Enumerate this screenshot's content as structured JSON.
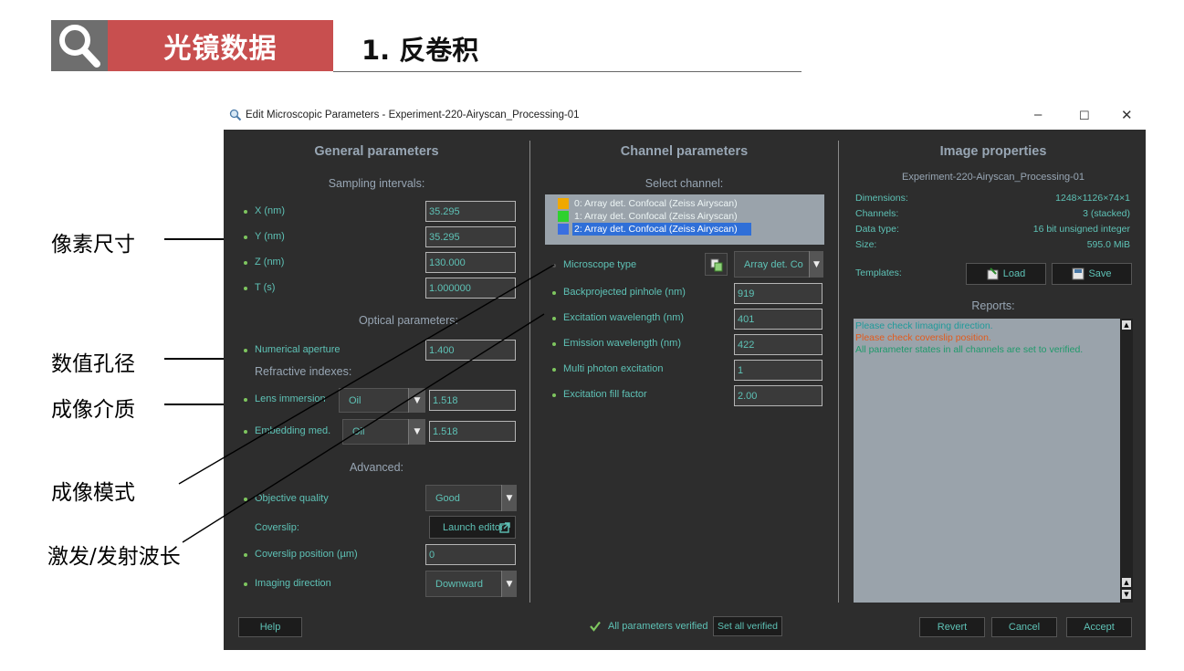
{
  "header": {
    "badge": "光镜数据",
    "title": "1. 反卷积"
  },
  "annotations": {
    "pixel_size": "像素尺寸",
    "numerical_aperture": "数值孔径",
    "imaging_medium": "成像介质",
    "imaging_mode": "成像模式",
    "excitation_emission": "激发/发射波长"
  },
  "window": {
    "title": "Edit Microscopic Parameters - Experiment-220-Airyscan_Processing-01",
    "minimize": "–",
    "maximize": "☐",
    "close": "✕"
  },
  "general": {
    "title": "General parameters",
    "sampling_title": "Sampling intervals:",
    "x_label": "X (nm)",
    "x_value": "35.295",
    "y_label": "Y (nm)",
    "y_value": "35.295",
    "z_label": "Z (nm)",
    "z_value": "130.000",
    "t_label": "T (s)",
    "t_value": "1.000000",
    "optical_title": "Optical parameters:",
    "na_label": "Numerical aperture",
    "na_value": "1.400",
    "refractive_title": "Refractive indexes:",
    "lens_label": "Lens immersion",
    "lens_medium": "Oil",
    "lens_value": "1.518",
    "embed_label": "Embedding med.",
    "embed_medium": "Oil",
    "embed_value": "1.518",
    "advanced_title": "Advanced:",
    "objective_label": "Objective quality",
    "objective_value": "Good",
    "coverslip_label": "Coverslip:",
    "launch_editor": "Launch editor",
    "coverslip_pos_label": "Coverslip position (µm)",
    "coverslip_pos_value": "0",
    "imaging_dir_label": "Imaging direction",
    "imaging_dir_value": "Downward"
  },
  "channel": {
    "title": "Channel parameters",
    "select_title": "Select channel:",
    "channels": [
      {
        "label": "0: Array det. Confocal (Zeiss Airyscan)",
        "color": "#f0a800"
      },
      {
        "label": "1: Array det. Confocal (Zeiss Airyscan)",
        "color": "#2ed12e"
      },
      {
        "label": "2: Array det. Confocal (Zeiss Airyscan)",
        "color": "#3a6fe0"
      }
    ],
    "microscope_label": "Microscope type",
    "microscope_value": "Array det. Co",
    "pinhole_label": "Backprojected pinhole (nm)",
    "pinhole_value": "919",
    "excitation_label": "Excitation wavelength (nm)",
    "excitation_value": "401",
    "emission_label": "Emission wavelength (nm)",
    "emission_value": "422",
    "multiphoton_label": "Multi photon excitation",
    "multiphoton_value": "1",
    "fill_label": "Excitation fill factor",
    "fill_value": "2.00"
  },
  "image": {
    "title": "Image properties",
    "name": "Experiment-220-Airyscan_Processing-01",
    "dimensions_label": "Dimensions:",
    "dimensions_value": "1248×1126×74×1",
    "channels_label": "Channels:",
    "channels_value": "3 (stacked)",
    "datatype_label": "Data type:",
    "datatype_value": "16 bit unsigned integer",
    "size_label": "Size:",
    "size_value": "595.0 MiB",
    "templates_label": "Templates:",
    "load": "Load",
    "save": "Save",
    "reports_title": "Reports:",
    "report_1": "Please check Iimaging direction.",
    "report_2": "Please check coverslip position.",
    "report_3": "All parameter states in all channels are set to verified."
  },
  "footer": {
    "help": "Help",
    "verified_text": "All parameters verified",
    "set_verified": "Set all verified",
    "revert": "Revert",
    "cancel": "Cancel",
    "accept": "Accept"
  },
  "colors": {
    "label_teal": "#5ec2b6",
    "title_gray": "#98a6b4",
    "report_warning": "#e25a1c",
    "report_ok": "#1f9a6b",
    "bullet_green": "#7ec65f"
  }
}
